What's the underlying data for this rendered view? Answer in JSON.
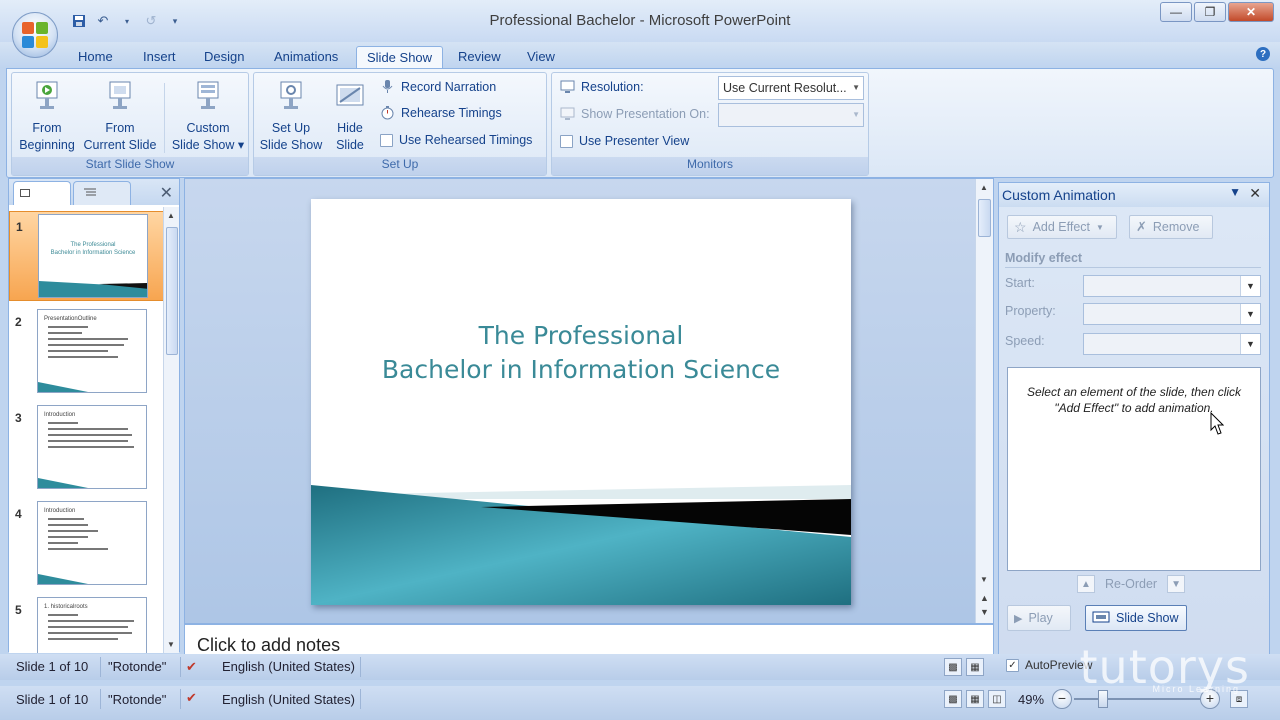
{
  "window": {
    "title": "Professional Bachelor - Microsoft PowerPoint"
  },
  "qat": {
    "icons": [
      "save-icon",
      "undo-icon",
      "redo-icon",
      "customize-icon"
    ]
  },
  "tabs": [
    {
      "label": "Home"
    },
    {
      "label": "Insert"
    },
    {
      "label": "Design"
    },
    {
      "label": "Animations"
    },
    {
      "label": "Slide Show",
      "active": true
    },
    {
      "label": "Review"
    },
    {
      "label": "View"
    }
  ],
  "ribbon": {
    "start_group": {
      "label": "Start Slide Show",
      "from_beginning": [
        "From",
        "Beginning"
      ],
      "from_current": [
        "From",
        "Current Slide"
      ],
      "custom": [
        "Custom",
        "Slide Show ▾"
      ]
    },
    "setup_group": {
      "label": "Set Up",
      "setup": [
        "Set Up",
        "Slide Show"
      ],
      "hide": [
        "Hide",
        "Slide"
      ],
      "record_narration": "Record Narration",
      "rehearse_timings": "Rehearse Timings",
      "use_rehearsed": "Use Rehearsed Timings"
    },
    "monitors_group": {
      "label": "Monitors",
      "resolution_label": "Resolution:",
      "resolution_value": "Use Current Resolut...",
      "show_on_label": "Show Presentation On:",
      "presenter_view": "Use Presenter View"
    }
  },
  "slides": [
    {
      "num": "1",
      "title": [
        "The Professional",
        "Bachelor in Information Science"
      ],
      "selected": true
    },
    {
      "num": "2",
      "head": "PresentationOutline"
    },
    {
      "num": "3",
      "head": "Introduction"
    },
    {
      "num": "4",
      "head": "Introduction"
    },
    {
      "num": "5",
      "head": "1.  historicalroots"
    }
  ],
  "main_slide": {
    "title_line1": "The Professional",
    "title_line2": "Bachelor in Information Science"
  },
  "notes": {
    "placeholder": "Click to add notes"
  },
  "task_pane": {
    "title": "Custom Animation",
    "add_effect": "Add Effect",
    "remove": "Remove",
    "modify_effect": "Modify effect",
    "start_label": "Start:",
    "property_label": "Property:",
    "speed_label": "Speed:",
    "message": "Select an element of the slide, then click \"Add Effect\" to add animation.",
    "reorder": "Re-Order",
    "play": "Play",
    "slide_show": "Slide Show",
    "autopreview": "AutoPreview"
  },
  "statusbar": {
    "slide_info": "Slide 1 of 10",
    "theme": "\"Rotonde\"",
    "language": "English (United States)",
    "zoom": "49%"
  },
  "watermark": {
    "brand": "tutorys",
    "tagline": "Micro Learning"
  },
  "colors": {
    "accent": "#15428b",
    "slide_title": "#3a8a97",
    "ribbon_bg": "#dbe7f6"
  }
}
